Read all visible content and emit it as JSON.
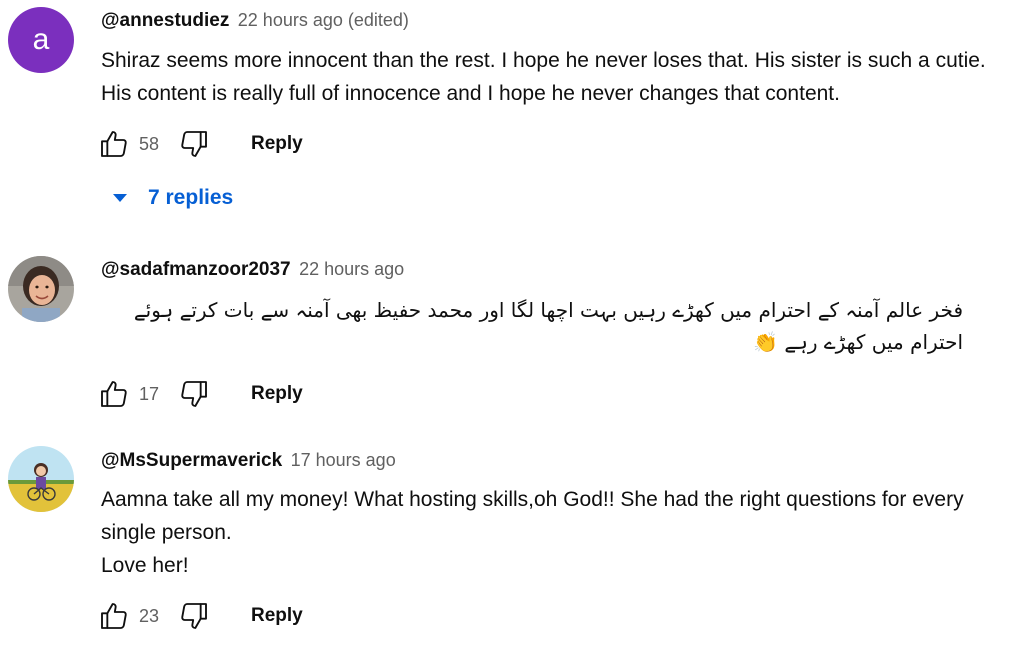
{
  "comments": [
    {
      "avatar_letter": "a",
      "author": "@annestudiez",
      "time": "22 hours ago (edited)",
      "text": "Shiraz seems more innocent than the rest. I hope he never loses that. His sister is such a cutie. His content is really full of innocence and I hope he never changes that content.",
      "likes": "58",
      "reply_label": "Reply",
      "replies_label": "7 replies"
    },
    {
      "author": "@sadafmanzoor2037",
      "time": "22 hours ago",
      "text": "فخر عالم آمنہ کے احترام میں کھڑے رہیں بہت اچھا لگا اور محمد حفیظ بھی آمنہ سے بات کرتے ہوئے احترام میں کھڑے رہے 👏",
      "likes": "17",
      "reply_label": "Reply"
    },
    {
      "author": "@MsSupermaverick",
      "time": "17 hours ago",
      "text_lines": [
        "Aamna take all my money! What hosting skills,oh God!! She had the right questions for every single person.",
        "Love her!"
      ],
      "likes": "23",
      "reply_label": "Reply"
    }
  ],
  "colors": {
    "link_blue": "#065fd4",
    "avatar_purple": "#7b2fbe",
    "meta_gray": "#606060"
  },
  "icons": [
    "like-icon",
    "dislike-icon",
    "caret-down-icon"
  ]
}
